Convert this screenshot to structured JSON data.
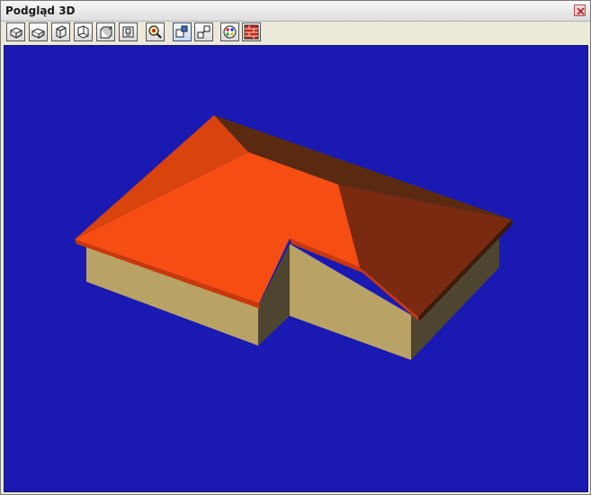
{
  "window": {
    "title": "Podgląd 3D"
  },
  "toolbar": {
    "buttons": [
      {
        "name": "view-top-button",
        "icon": "view-top-icon"
      },
      {
        "name": "view-front-button",
        "icon": "view-front-icon"
      },
      {
        "name": "view-left-button",
        "icon": "view-left-icon"
      },
      {
        "name": "view-right-button",
        "icon": "view-right-icon"
      },
      {
        "name": "view-back-button",
        "icon": "view-back-icon"
      },
      {
        "name": "view-iso-button",
        "icon": "view-iso-icon"
      },
      {
        "name": "zoom-button",
        "icon": "magnifier-icon"
      },
      {
        "name": "select-mode-button",
        "icon": "select-icon",
        "pressed": true
      },
      {
        "name": "rotate-mode-button",
        "icon": "rotate-icon"
      },
      {
        "name": "color-button",
        "icon": "palette-icon"
      },
      {
        "name": "texture-button",
        "icon": "brick-wall-icon"
      }
    ]
  },
  "scene": {
    "background_color": "#1a1ab2",
    "roof_color": "#f54d12",
    "roof_shadow_color": "#7a2a10",
    "wall_color": "#b8a265",
    "wall_shadow_color": "#4d4530"
  }
}
